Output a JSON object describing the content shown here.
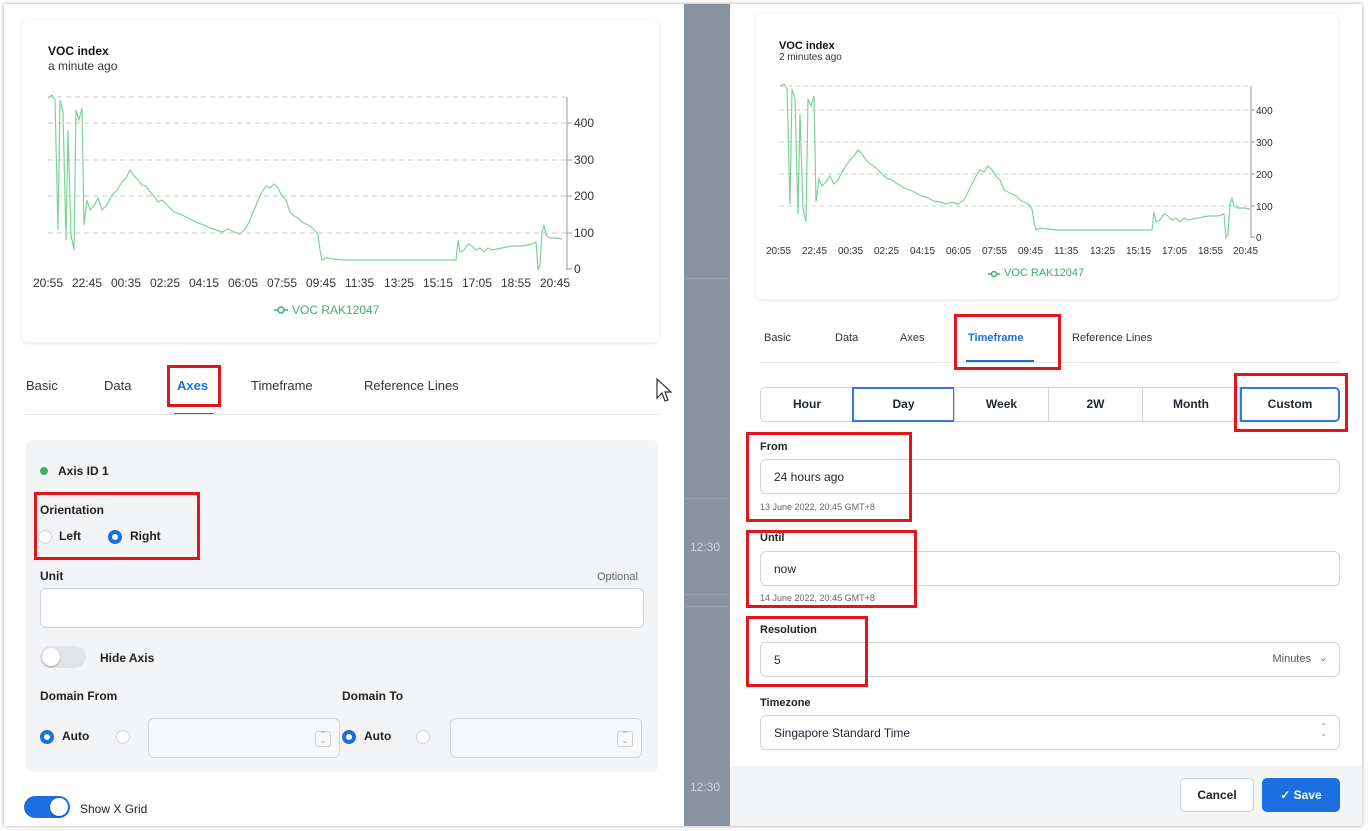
{
  "left_panel": {
    "chart": {
      "title": "VOC index",
      "subtitle": "a minute ago",
      "y_ticks": [
        "400",
        "300",
        "200",
        "100",
        "0"
      ],
      "x_ticks": [
        "20:55",
        "22:45",
        "00:35",
        "02:25",
        "04:15",
        "06:05",
        "07:55",
        "09:45",
        "11:35",
        "13:25",
        "15:15",
        "17:05",
        "18:55",
        "20:45"
      ],
      "legend": "VOC RAK12047"
    },
    "tabs": [
      "Basic",
      "Data",
      "Axes",
      "Timeframe",
      "Reference Lines"
    ],
    "active_tab": "Axes",
    "axis": {
      "id_label": "Axis ID 1",
      "orientation_label": "Orientation",
      "orientation_left": "Left",
      "orientation_right": "Right",
      "unit_label": "Unit",
      "unit_hint": "Optional",
      "unit_value": "",
      "hide_axis_label": "Hide Axis",
      "domain_from_label": "Domain From",
      "domain_to_label": "Domain To",
      "auto_label": "Auto",
      "show_x_grid_label": "Show X Grid"
    }
  },
  "divider": {
    "time1": "12:30",
    "time2": "12:30"
  },
  "right_panel": {
    "chart": {
      "title": "VOC index",
      "subtitle": "2 minutes ago",
      "y_ticks": [
        "400",
        "300",
        "200",
        "100",
        "0"
      ],
      "x_ticks": [
        "20:55",
        "22:45",
        "00:35",
        "02:25",
        "04:15",
        "06:05",
        "07:55",
        "09:45",
        "11:35",
        "13:25",
        "15:15",
        "17:05",
        "18:55",
        "20:45"
      ],
      "legend": "VOC RAK12047"
    },
    "tabs": [
      "Basic",
      "Data",
      "Axes",
      "Timeframe",
      "Reference Lines"
    ],
    "active_tab": "Timeframe",
    "timeframe": {
      "options": [
        "Hour",
        "Day",
        "Week",
        "2W",
        "Month",
        "Custom"
      ],
      "from_label": "From",
      "from_value": "24 hours ago",
      "from_resolved": "13 June 2022, 20:45 GMT+8",
      "until_label": "Until",
      "until_value": "now",
      "until_resolved": "14 June 2022, 20:45 GMT+8",
      "resolution_label": "Resolution",
      "resolution_value": "5",
      "resolution_unit": "Minutes",
      "timezone_label": "Timezone",
      "timezone_value": "Singapore Standard Time"
    },
    "buttons": {
      "cancel": "Cancel",
      "save": "Save"
    }
  },
  "colors": {
    "accent": "#1b6fe0",
    "highlight": "#e3141b",
    "series": "#3fae6a"
  }
}
